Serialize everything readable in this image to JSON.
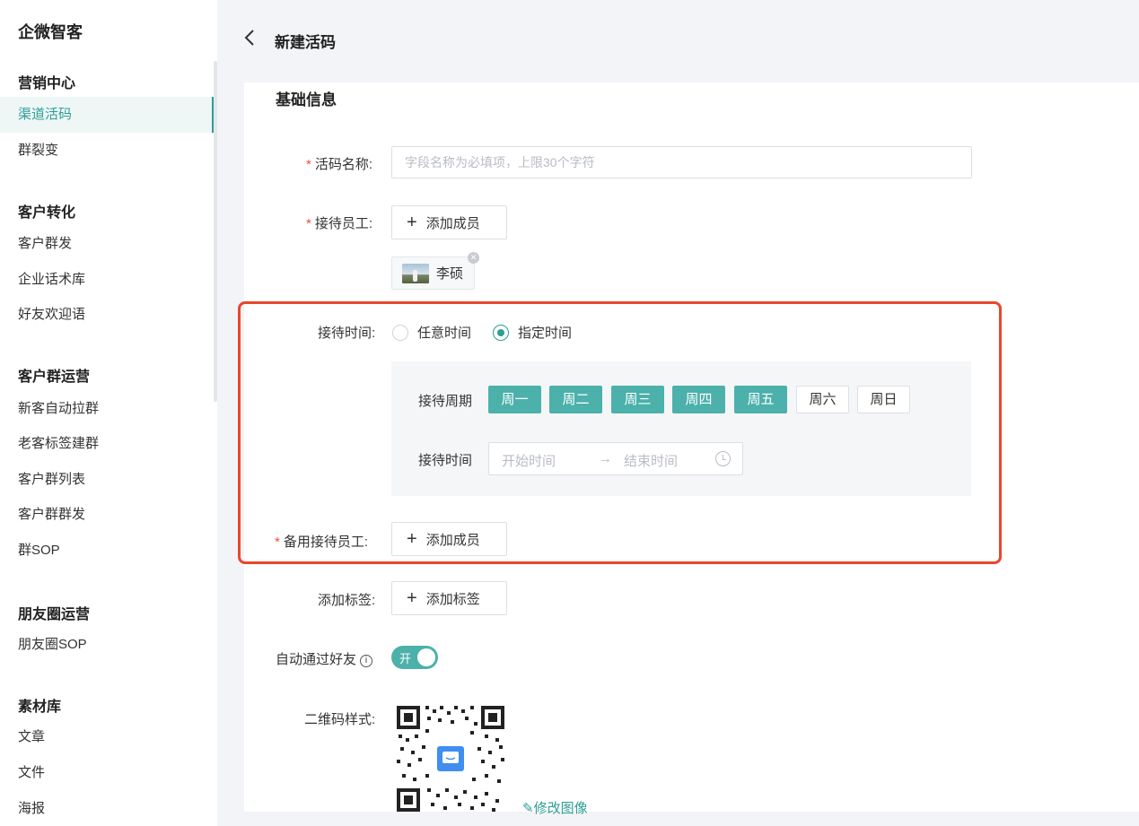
{
  "app": {
    "name": "企微智客"
  },
  "sidebar": {
    "sections": [
      {
        "title": "营销中心",
        "items": [
          "渠道活码",
          "群裂变"
        ]
      },
      {
        "title": "客户转化",
        "items": [
          "客户群发",
          "企业话术库",
          "好友欢迎语"
        ]
      },
      {
        "title": "客户群运营",
        "items": [
          "新客自动拉群",
          "老客标签建群",
          "客户群列表",
          "客户群群发",
          "群SOP"
        ]
      },
      {
        "title": "朋友圈运营",
        "items": [
          "朋友圈SOP"
        ]
      },
      {
        "title": "素材库",
        "items": [
          "文章",
          "文件",
          "海报"
        ]
      }
    ],
    "active_item": "渠道活码"
  },
  "header": {
    "back_icon": "chevron-left-icon",
    "title": "新建活码"
  },
  "form": {
    "section_title": "基础信息",
    "required_mark": "*",
    "code_name": {
      "label": "活码名称:",
      "value": "",
      "placeholder": "字段名称为必填项，上限30个字符"
    },
    "staff": {
      "label": "接待员工:",
      "add_button": "添加成员",
      "members": [
        {
          "name": "李硕"
        }
      ]
    },
    "reception_time": {
      "label": "接待时间:",
      "options": [
        "任意时间",
        "指定时间"
      ],
      "selected": "指定时间",
      "period_label": "接待周期",
      "days": [
        {
          "label": "周一",
          "selected": true
        },
        {
          "label": "周二",
          "selected": true
        },
        {
          "label": "周三",
          "selected": true
        },
        {
          "label": "周四",
          "selected": true
        },
        {
          "label": "周五",
          "selected": true
        },
        {
          "label": "周六",
          "selected": false
        },
        {
          "label": "周日",
          "selected": false
        }
      ],
      "time_label": "接待时间",
      "start_placeholder": "开始时间",
      "range_arrow": "→",
      "end_placeholder": "结束时间"
    },
    "backup_staff": {
      "label": "备用接待员工:",
      "add_button": "添加成员"
    },
    "tags": {
      "label": "添加标签:",
      "add_button": "添加标签"
    },
    "auto_accept": {
      "label": "自动通过好友",
      "info_icon": "ⓘ",
      "toggle_text": "开",
      "enabled": true
    },
    "qr_style": {
      "label": "二维码样式:",
      "edit_link": "修改图像",
      "edit_icon": "pencil-icon"
    }
  },
  "colors": {
    "accent": "#4cb1aa",
    "required": "#ef4d3d",
    "highlight": "#e8472c"
  }
}
